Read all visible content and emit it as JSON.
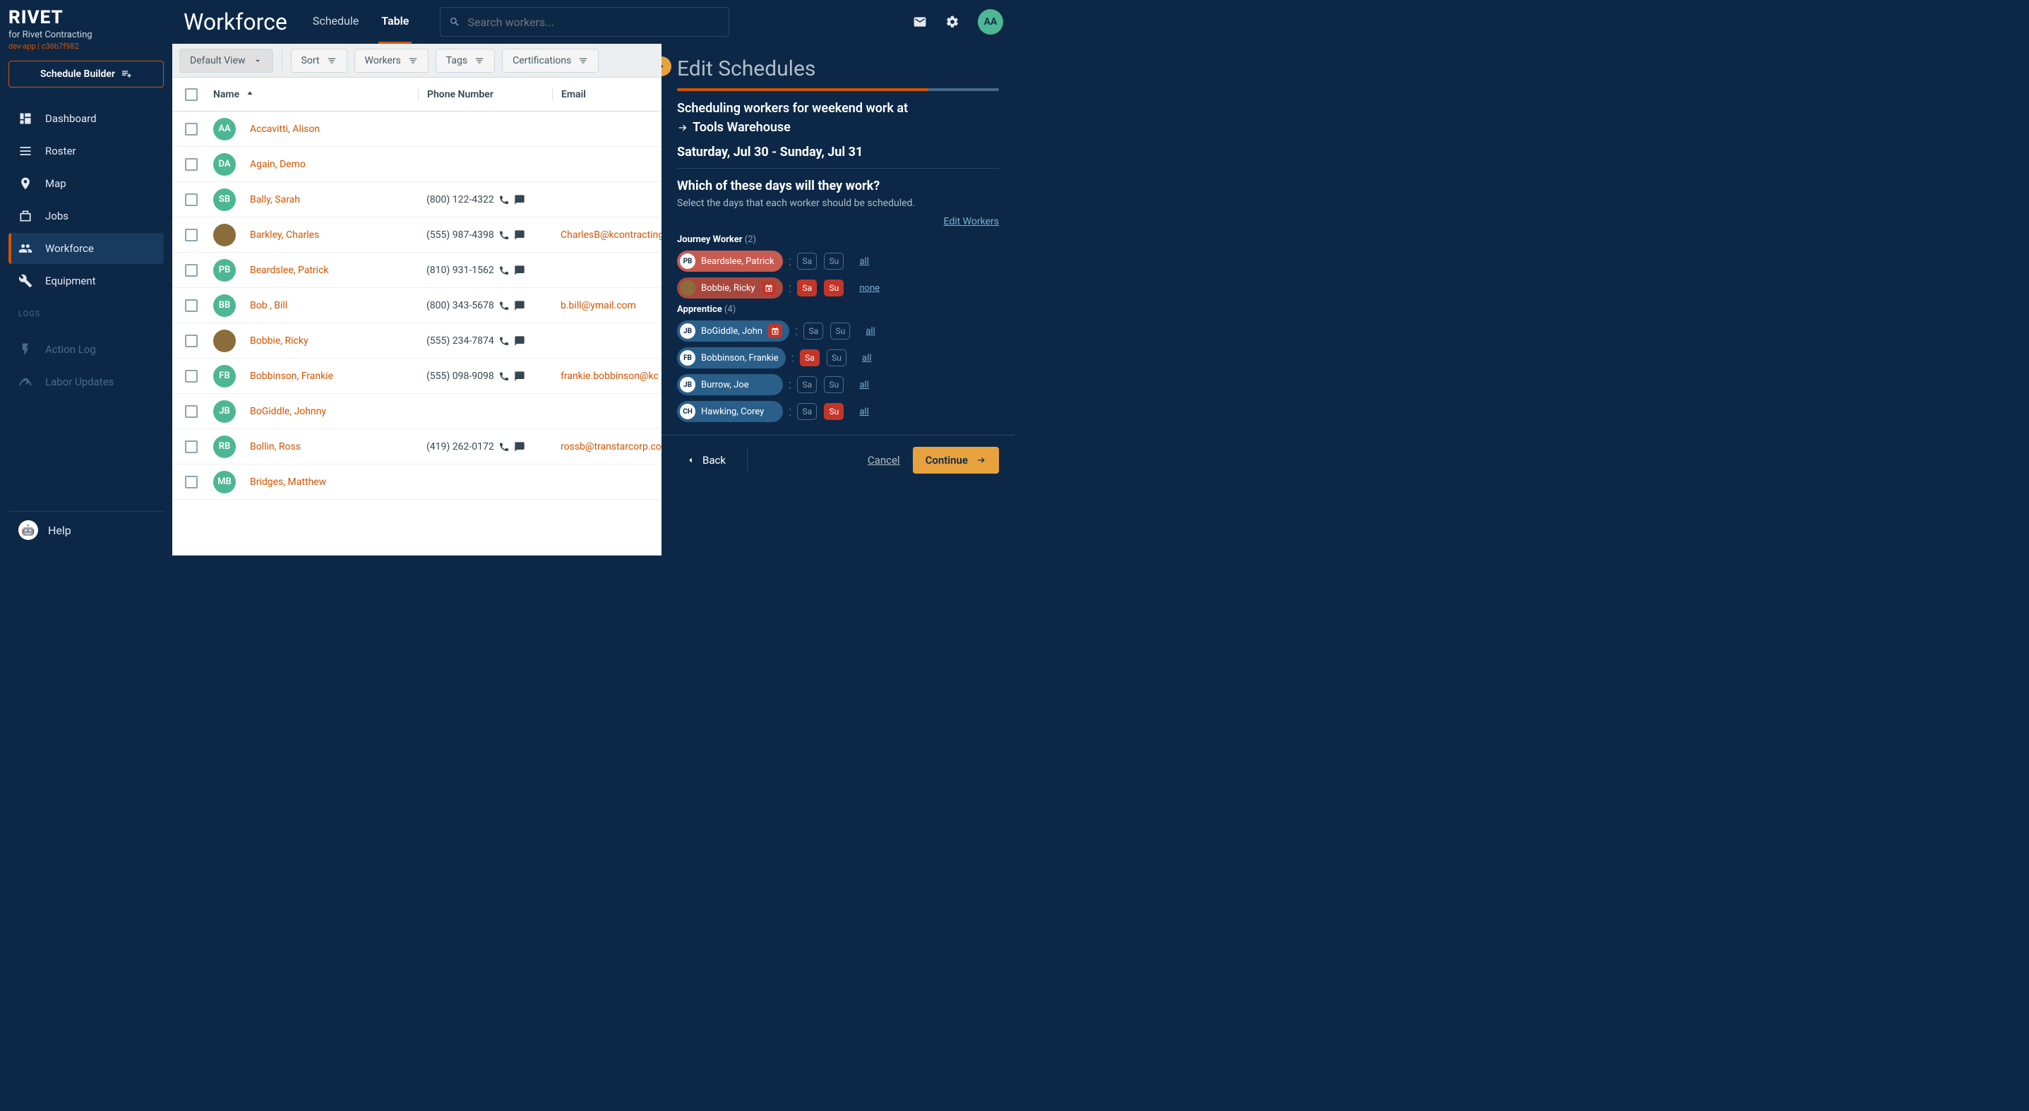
{
  "brand": {
    "name": "RIVET",
    "subtitle": "for Rivet Contracting",
    "meta": "dev-app | c36b7f982"
  },
  "schedule_builder_label": "Schedule Builder",
  "nav": {
    "items": [
      {
        "label": "Dashboard",
        "active": false
      },
      {
        "label": "Roster",
        "active": false
      },
      {
        "label": "Map",
        "active": false
      },
      {
        "label": "Jobs",
        "active": false
      },
      {
        "label": "Workforce",
        "active": true
      },
      {
        "label": "Equipment",
        "active": false
      }
    ],
    "logs_section": "LOGS",
    "logs": [
      {
        "label": "Action Log"
      },
      {
        "label": "Labor Updates"
      }
    ],
    "help": "Help"
  },
  "page_title": "Workforce",
  "tabs": [
    {
      "label": "Schedule",
      "active": false
    },
    {
      "label": "Table",
      "active": true
    }
  ],
  "search_placeholder": "Search workers...",
  "top_avatar": "AA",
  "filters": {
    "view": "Default View",
    "chips": [
      "Sort",
      "Workers",
      "Tags",
      "Certifications"
    ]
  },
  "table": {
    "headers": {
      "name": "Name",
      "phone": "Phone Number",
      "email": "Email"
    },
    "rows": [
      {
        "initials": "AA",
        "name": "Accavitti, Alison",
        "phone": "",
        "email": ""
      },
      {
        "initials": "DA",
        "name": "Again, Demo",
        "phone": "",
        "email": ""
      },
      {
        "initials": "SB",
        "name": "Bally, Sarah",
        "phone": "(800) 122-4322",
        "email": ""
      },
      {
        "initials": "",
        "name": "Barkley, Charles",
        "phone": "(555) 987-4398",
        "email": "CharlesB@kcontracting",
        "img": true
      },
      {
        "initials": "PB",
        "name": "Beardslee, Patrick",
        "phone": "(810) 931-1562",
        "email": ""
      },
      {
        "initials": "BB",
        "name": "Bob , Bill",
        "phone": "(800) 343-5678",
        "email": "b.bill@ymail.com"
      },
      {
        "initials": "",
        "name": "Bobbie, Ricky",
        "phone": "(555) 234-7874",
        "email": "",
        "img": true
      },
      {
        "initials": "FB",
        "name": "Bobbinson, Frankie",
        "phone": "(555) 098-9098",
        "email": "frankie.bobbinson@kc"
      },
      {
        "initials": "JB",
        "name": "BoGiddle, Johnny",
        "phone": "",
        "email": ""
      },
      {
        "initials": "RB",
        "name": "Bollin, Ross",
        "phone": "(419) 262-0172",
        "email": "rossb@transtarcorp.co"
      },
      {
        "initials": "MB",
        "name": "Bridges, Matthew",
        "phone": "",
        "email": ""
      }
    ]
  },
  "drawer": {
    "title": "Edit Schedules",
    "scheduling_prefix": "Scheduling workers for weekend work at",
    "job_name": "Tools Warehouse",
    "date_range": "Saturday, Jul 30 - Sunday, Jul 31",
    "question": "Which of these days will they work?",
    "instruction": "Select the days that each worker should be scheduled.",
    "edit_workers": "Edit Workers",
    "groups": [
      {
        "label": "Journey Worker",
        "count": "(2)",
        "workers": [
          {
            "initials": "PB",
            "name": "Beardslee, Patrick",
            "color": "red",
            "sa": false,
            "su": false,
            "link": "all",
            "cal": false
          },
          {
            "initials": "",
            "name": "Bobbie, Ricky",
            "color": "red-dark",
            "sa": true,
            "su": true,
            "link": "none",
            "cal": true,
            "img": true
          }
        ]
      },
      {
        "label": "Apprentice",
        "count": "(4)",
        "workers": [
          {
            "initials": "JB",
            "name": "BoGiddle, John",
            "color": "blue",
            "sa": false,
            "su": false,
            "link": "all",
            "cal": true
          },
          {
            "initials": "FB",
            "name": "Bobbinson, Frankie",
            "color": "blue",
            "sa": true,
            "su": false,
            "link": "all",
            "cal": false
          },
          {
            "initials": "JB",
            "name": "Burrow, Joe",
            "color": "blue",
            "sa": false,
            "su": false,
            "link": "all",
            "cal": false
          },
          {
            "initials": "CH",
            "name": "Hawking, Corey",
            "color": "blue",
            "sa": false,
            "su": true,
            "link": "all",
            "cal": false
          }
        ]
      }
    ],
    "days": {
      "sa": "Sa",
      "su": "Su"
    },
    "back": "Back",
    "cancel": "Cancel",
    "continue": "Continue"
  }
}
